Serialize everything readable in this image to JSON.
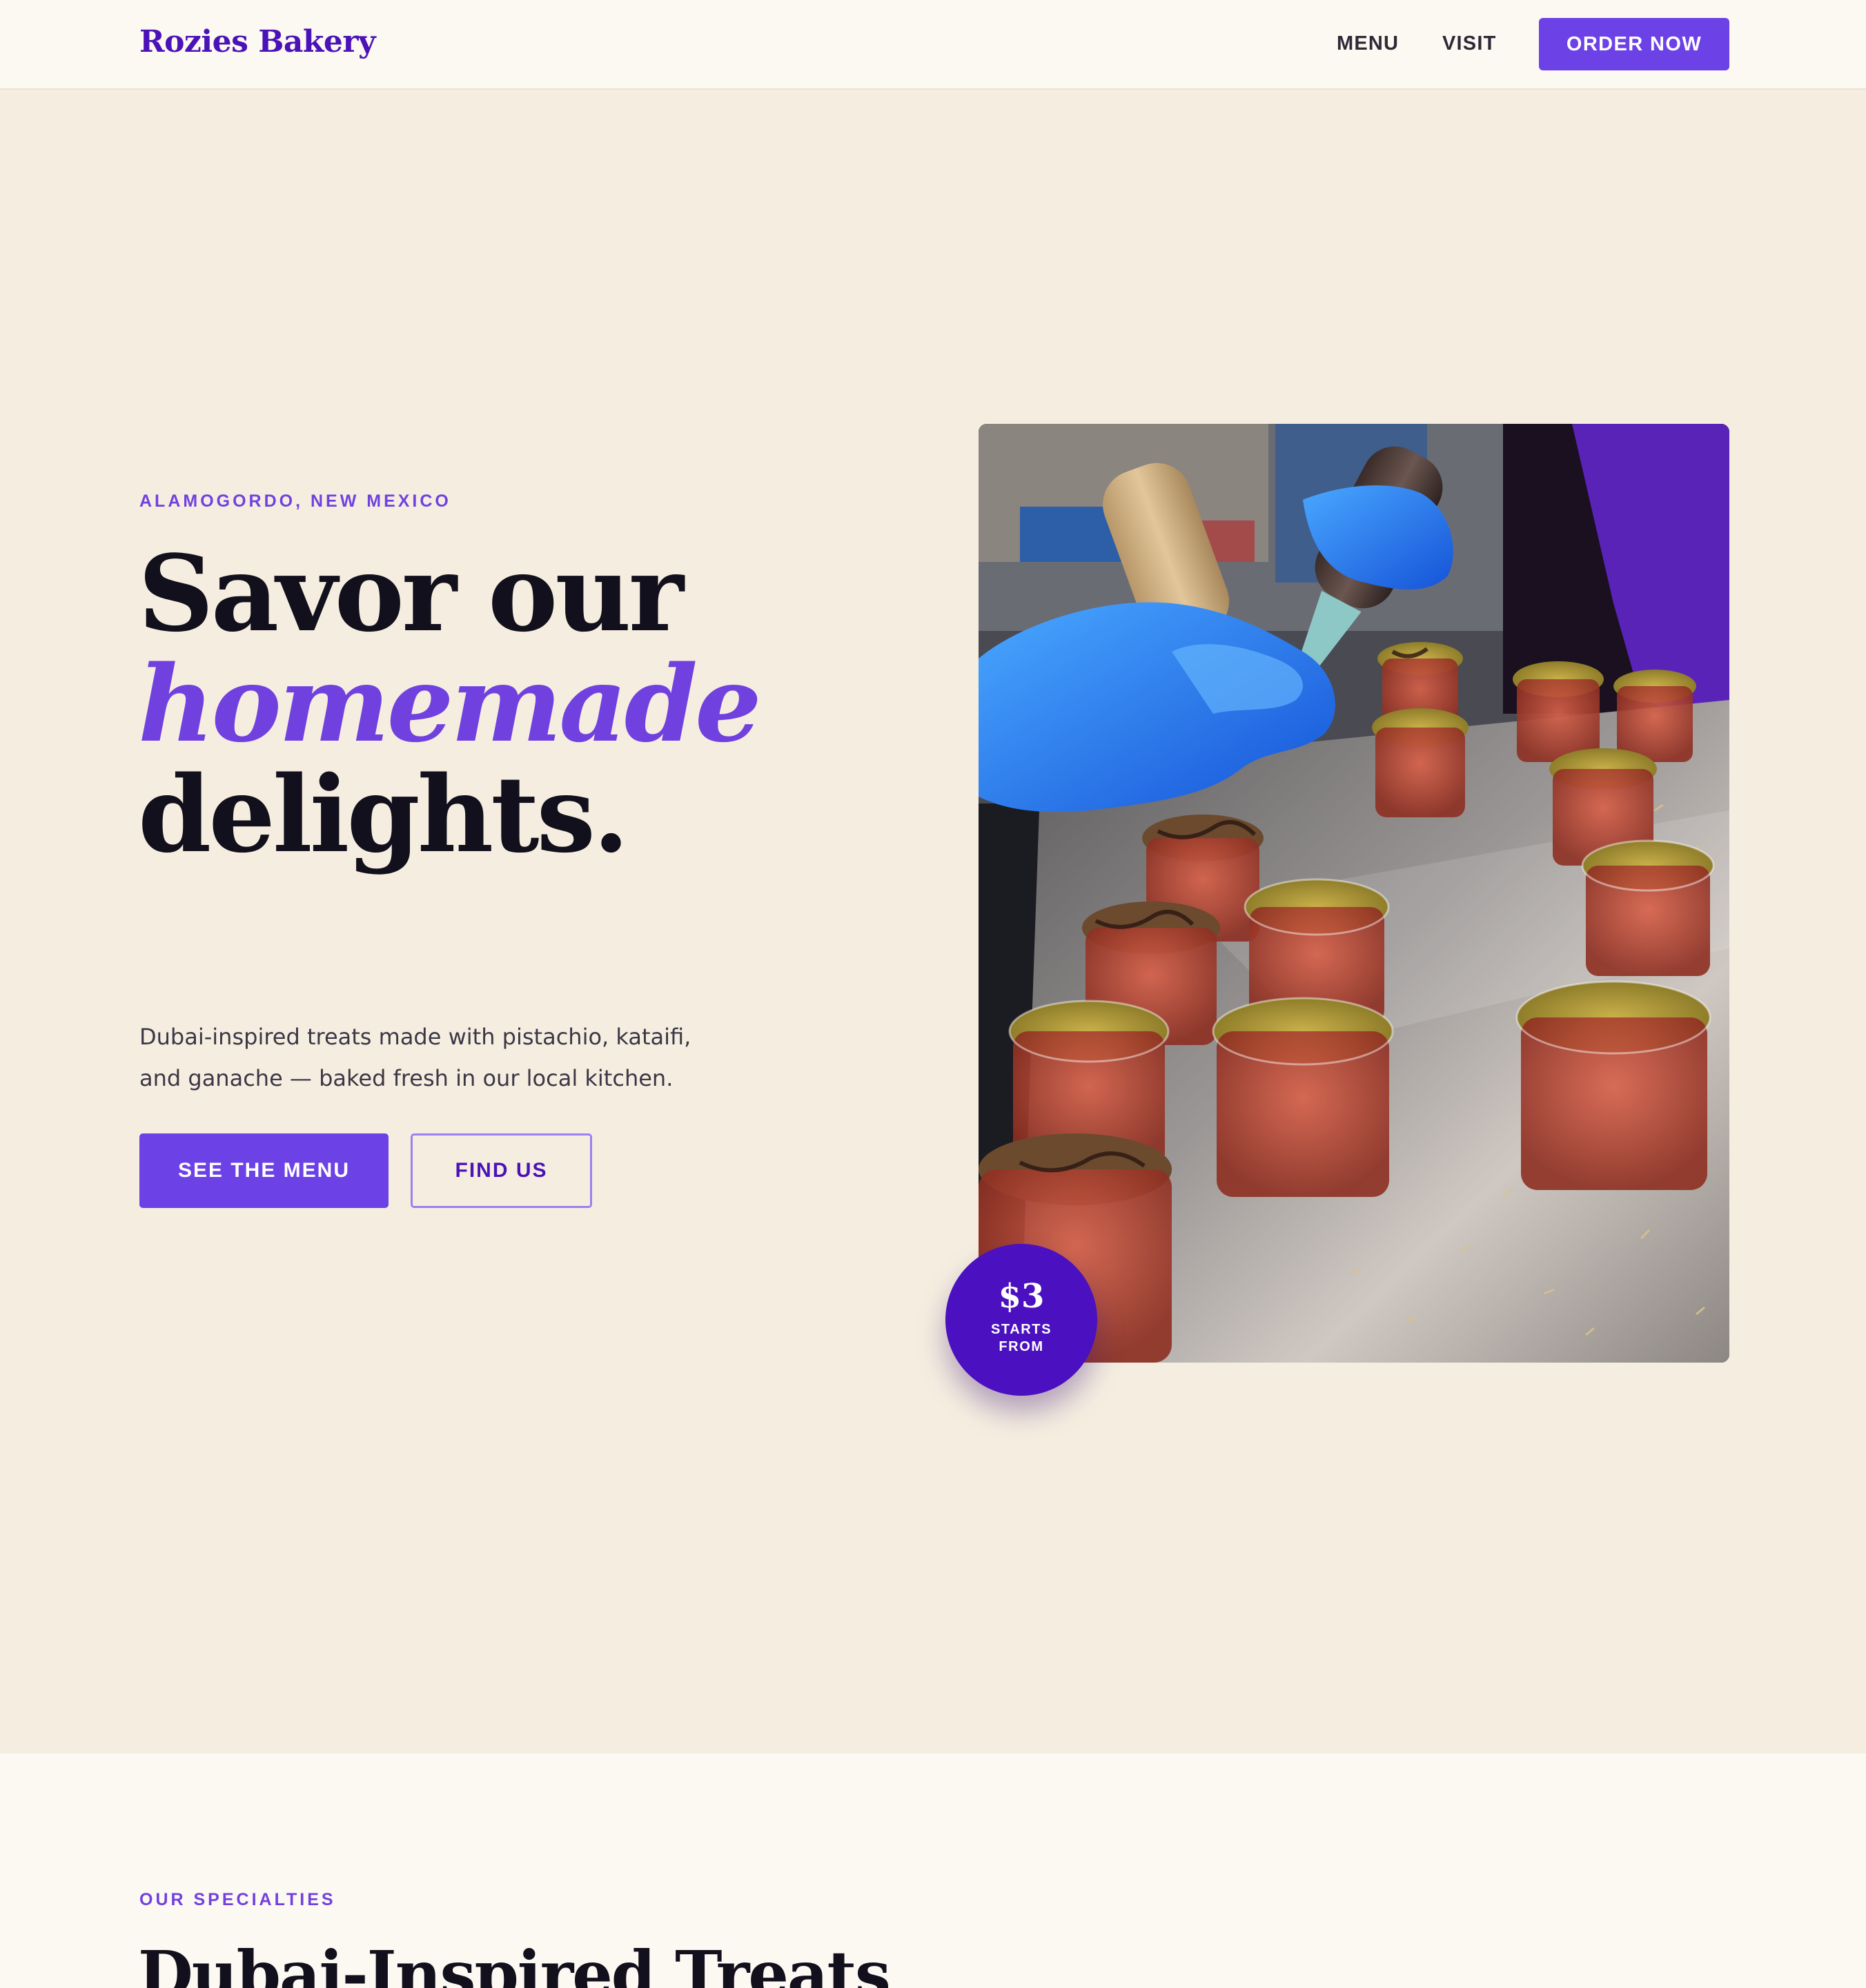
{
  "brand": {
    "name": "Rozies Bakery"
  },
  "nav": {
    "links": [
      "MENU",
      "VISIT"
    ],
    "cta": "ORDER NOW"
  },
  "hero": {
    "eyebrow": "ALAMOGORDO, NEW MEXICO",
    "headline": {
      "line1": "Savor our",
      "line2": "homemade",
      "line3": "delights."
    },
    "description": "Dubai-inspired treats made with pistachio, kataifi, and ganache — baked fresh in our local kitchen.",
    "buttons": {
      "primary": "SEE THE MENU",
      "secondary": "FIND US"
    },
    "badge": {
      "price": "$3",
      "caption": "STARTS FROM"
    }
  },
  "specialties": {
    "eyebrow": "OUR SPECIALTIES",
    "title": "Dubai-Inspired Treats"
  },
  "colors": {
    "accent": "#6c41e6",
    "brand_dark": "#4b12b8",
    "hero_bg": "#f5eee0",
    "nav_bg": "#fcf8f2",
    "text": "#12101c"
  }
}
